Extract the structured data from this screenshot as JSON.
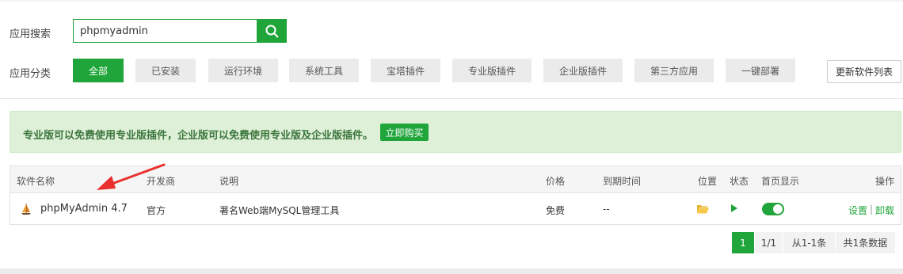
{
  "search": {
    "label": "应用搜索",
    "value": "phpmyadmin"
  },
  "category": {
    "label": "应用分类",
    "items": [
      {
        "label": "全部",
        "active": true
      },
      {
        "label": "已安装"
      },
      {
        "label": "运行环境"
      },
      {
        "label": "系统工具"
      },
      {
        "label": "宝塔插件"
      },
      {
        "label": "专业版插件"
      },
      {
        "label": "企业版插件"
      },
      {
        "label": "第三方应用"
      },
      {
        "label": "一键部署"
      }
    ],
    "update_label": "更新软件列表"
  },
  "notice": {
    "text": "专业版可以免费使用专业版插件，企业版可以免费使用专业版及企业版插件。",
    "buy_label": "立即购买"
  },
  "table": {
    "headers": {
      "name": "软件名称",
      "developer": "开发商",
      "desc": "说明",
      "price": "价格",
      "expire": "到期时间",
      "location": "位置",
      "status": "状态",
      "homepage": "首页显示",
      "ops": "操作"
    },
    "rows": [
      {
        "name": "phpMyAdmin 4.7",
        "developer": "官方",
        "desc": "著名Web端MySQL管理工具",
        "price": "免费",
        "expire": "--",
        "homepage_on": true,
        "op_settings": "设置",
        "op_sep": "|",
        "op_uninstall": "卸载"
      }
    ]
  },
  "pager": {
    "current": "1",
    "pages": "1/1",
    "range": "从1-1条",
    "total": "共1条数据"
  },
  "colors": {
    "accent": "#20a53a",
    "notice_bg": "#dff0d8",
    "notice_text": "#3c763d",
    "arrow": "#e8312f"
  }
}
